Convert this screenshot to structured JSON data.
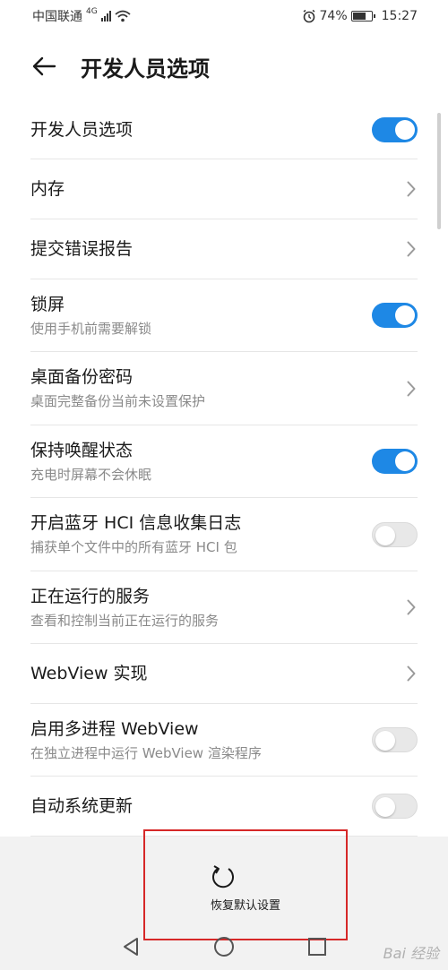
{
  "status_bar": {
    "carrier": "中国联通",
    "network": "4G",
    "battery": "74%",
    "battery_level": 0.74,
    "time": "15:27"
  },
  "app_bar": {
    "title": "开发人员选项"
  },
  "settings": [
    {
      "title": "开发人员选项",
      "subtitle": "",
      "control": "toggle",
      "state": "on"
    },
    {
      "title": "内存",
      "subtitle": "",
      "control": "chevron"
    },
    {
      "title": "提交错误报告",
      "subtitle": "",
      "control": "chevron"
    },
    {
      "title": "锁屏",
      "subtitle": "使用手机前需要解锁",
      "control": "toggle",
      "state": "on"
    },
    {
      "title": "桌面备份密码",
      "subtitle": "桌面完整备份当前未设置保护",
      "control": "chevron"
    },
    {
      "title": "保持唤醒状态",
      "subtitle": "充电时屏幕不会休眠",
      "control": "toggle",
      "state": "on"
    },
    {
      "title": "开启蓝牙 HCI 信息收集日志",
      "subtitle": "捕获单个文件中的所有蓝牙 HCI 包",
      "control": "toggle",
      "state": "off"
    },
    {
      "title": "正在运行的服务",
      "subtitle": "查看和控制当前正在运行的服务",
      "control": "chevron"
    },
    {
      "title": "WebView 实现",
      "subtitle": "",
      "control": "chevron"
    },
    {
      "title": "启用多进程 WebView",
      "subtitle": "在独立进程中运行 WebView 渲染程序",
      "control": "toggle",
      "state": "off"
    },
    {
      "title": "自动系统更新",
      "subtitle": "",
      "control": "toggle",
      "state": "off"
    }
  ],
  "bottom": {
    "reset_label": "恢复默认设置"
  },
  "watermark": "Bai 经验",
  "colors": {
    "accent": "#1e88e5",
    "highlight_border": "#d62828"
  }
}
